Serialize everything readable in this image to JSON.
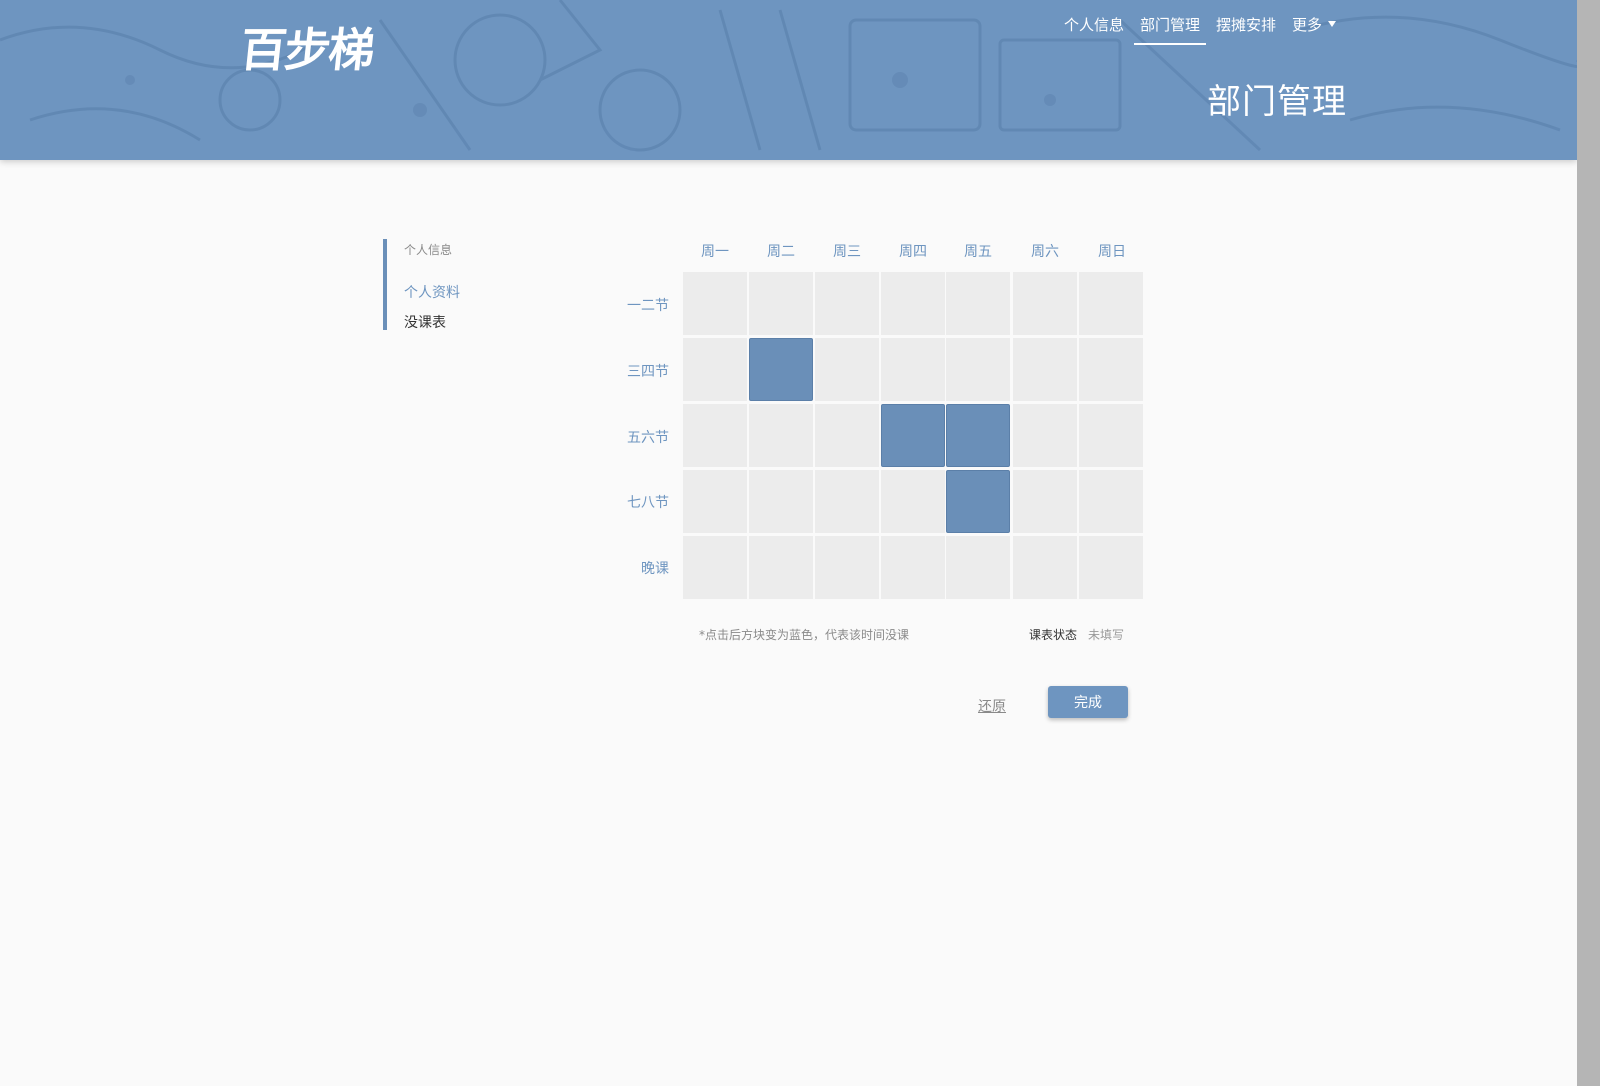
{
  "header": {
    "logo_text": "百步梯",
    "page_title": "部门管理",
    "nav": [
      {
        "label": "个人信息",
        "active": false
      },
      {
        "label": "部门管理",
        "active": true
      },
      {
        "label": "摆摊安排",
        "active": false
      },
      {
        "label": "更多",
        "active": false,
        "dropdown": true
      }
    ],
    "bg_color": "#6e95c0"
  },
  "sidebar": {
    "heading": "个人信息",
    "links": [
      {
        "label": "个人资料",
        "active": true
      },
      {
        "label": "没课表",
        "active": false
      }
    ]
  },
  "schedule": {
    "days": [
      "周一",
      "周二",
      "周三",
      "周四",
      "周五",
      "周六",
      "周日"
    ],
    "periods": [
      "一二节",
      "三四节",
      "五六节",
      "七八节",
      "晚课"
    ],
    "free_slots": [
      [
        false,
        false,
        false,
        false,
        false,
        false,
        false
      ],
      [
        false,
        true,
        false,
        false,
        false,
        false,
        false
      ],
      [
        false,
        false,
        false,
        true,
        true,
        false,
        false
      ],
      [
        false,
        false,
        false,
        false,
        true,
        false,
        false
      ],
      [
        false,
        false,
        false,
        false,
        false,
        false,
        false
      ]
    ],
    "hint": "*点击后方块变为蓝色，代表该时间没课",
    "status_label": "课表状态",
    "status_value": "未填写",
    "selected_color": "#6a8fb8",
    "empty_color": "#ececec"
  },
  "actions": {
    "reset_label": "还原",
    "done_label": "完成"
  }
}
